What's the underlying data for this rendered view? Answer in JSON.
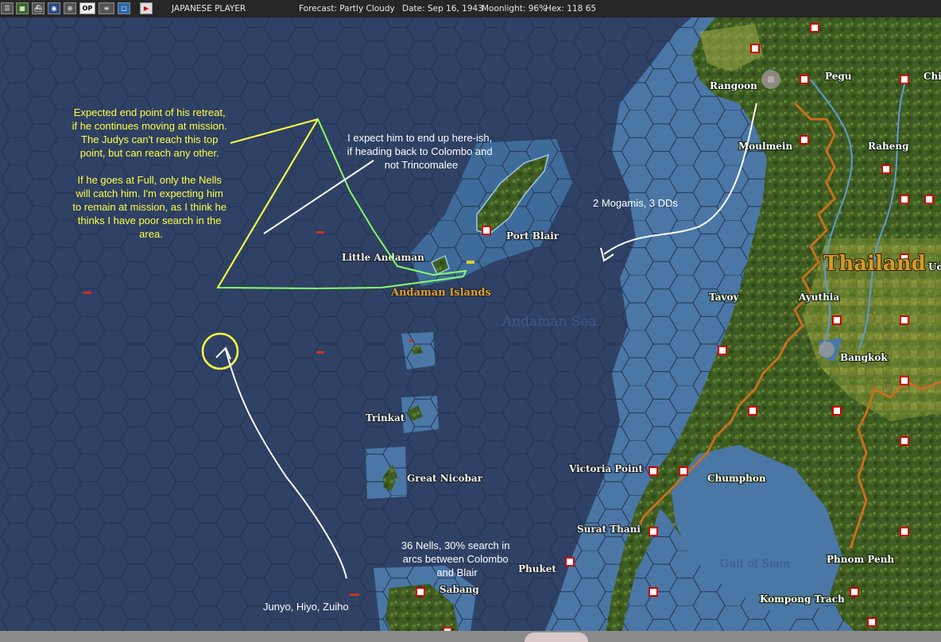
{
  "topbar": {
    "buttons": [
      "menu-icon",
      "map-icon",
      "ship-icon",
      "globe-icon",
      "target-icon",
      "ops-icon",
      "report-icon",
      "window-icon",
      "end-turn-icon"
    ],
    "ops_label": "OP",
    "player": "JAPANESE PLAYER",
    "forecast": "Forecast: Partly Cloudy",
    "date": "Date: Sep 16, 1943",
    "moonlight": "Moonlight: 96%",
    "hex": "Hex: 118 65"
  },
  "colors": {
    "sea": "#2f4165",
    "shallow": "#4a77a6",
    "land": "#3d5a20",
    "base": "#cc1111",
    "yellow": "#ffff44",
    "green": "#88ff66"
  },
  "map": {
    "places": [
      {
        "id": "rangoon",
        "name": "Rangoon"
      },
      {
        "id": "pegu",
        "name": "Pegu"
      },
      {
        "id": "chi",
        "name": "Chi"
      },
      {
        "id": "moulmein",
        "name": "Moulmein"
      },
      {
        "id": "raheng",
        "name": "Raheng"
      },
      {
        "id": "port-blair",
        "name": "Port Blair"
      },
      {
        "id": "little-andaman",
        "name": "Little Andaman"
      },
      {
        "id": "tavoy",
        "name": "Tavoy"
      },
      {
        "id": "ayuthia",
        "name": "Ayuthia"
      },
      {
        "id": "bangkok",
        "name": "Bangkok"
      },
      {
        "id": "trinkat",
        "name": "Trinkat"
      },
      {
        "id": "great-nicobar",
        "name": "Great Nicobar"
      },
      {
        "id": "victoria-point",
        "name": "Victoria Point"
      },
      {
        "id": "chumphon",
        "name": "Chumphon"
      },
      {
        "id": "surat-thani",
        "name": "Surat Thani"
      },
      {
        "id": "phuket",
        "name": "Phuket"
      },
      {
        "id": "sabang",
        "name": "Sabang"
      },
      {
        "id": "phnom-penh",
        "name": "Phnom Penh"
      },
      {
        "id": "kompong-trach",
        "name": "Kompong Trach"
      },
      {
        "id": "ud",
        "name": "Ud"
      }
    ],
    "regions": {
      "thailand": "Thailand",
      "andaman_islands": "Andaman Islands",
      "andaman_sea": "Andaman Sea",
      "gulf_of_siam": "Gulf of Siam"
    }
  },
  "annotations": {
    "yellow_note": [
      "Expected end point of his retreat,",
      "if he continues moving at mission.",
      "The Judys can't reach this top",
      "point, but can reach any other.",
      "",
      "If he goes at Full, only the Nells",
      "will catch him. I'm expecting him",
      "to remain at mission, as I think he",
      "thinks I have poor search in the",
      "area."
    ],
    "expect_note": [
      "I expect him to end up here-ish,",
      "if heading back to Colombo and",
      "not Trincomalee"
    ],
    "mogami_note": "2 Mogamis, 3 DDs",
    "nells_note": [
      "36 Nells, 30% search in",
      "arcs between Colombo",
      "and Blair"
    ],
    "carriers_note": "Junyo, Hiyo, Zuiho"
  }
}
